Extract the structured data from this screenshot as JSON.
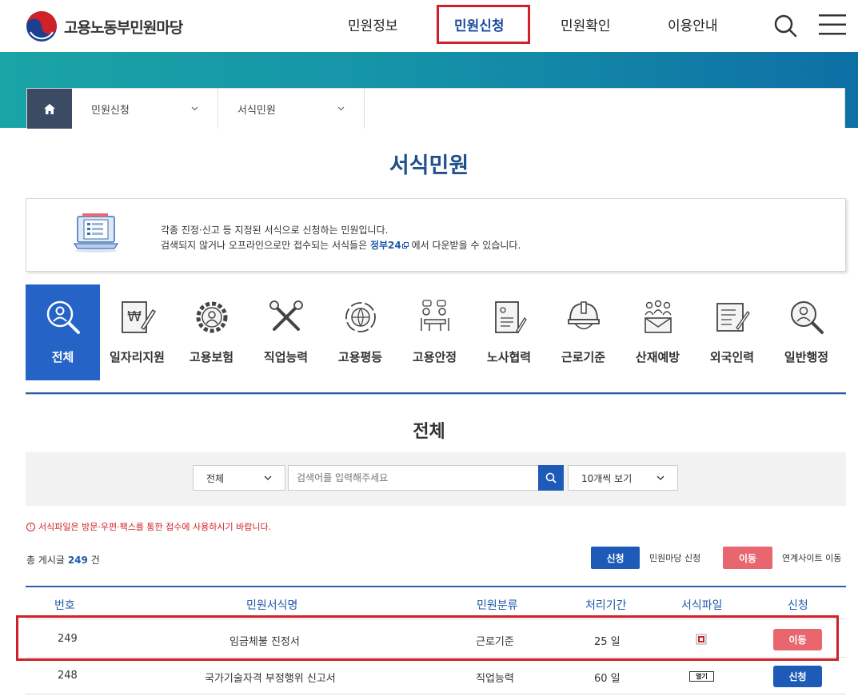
{
  "header": {
    "logo_text": "고용노동부민원마당",
    "nav": [
      "민원정보",
      "민원신청",
      "민원확인",
      "이용안내"
    ],
    "active_nav": "민원신청"
  },
  "breadcrumb": {
    "items": [
      "민원신청",
      "서식민원"
    ]
  },
  "page_title": "서식민원",
  "info": {
    "line1": "각종 진정·신고 등 지정된 서식으로 신청하는 민원입니다.",
    "line2_prefix": "검색되지 않거나 오프라인으로만 접수되는 서식들은",
    "link": "정부24",
    "line2_suffix": "에서 다운받을 수 있습니다."
  },
  "categories": [
    {
      "label": "전체",
      "icon": "magnifier-person-icon",
      "active": true
    },
    {
      "label": "일자리지원",
      "icon": "won-document-icon"
    },
    {
      "label": "고용보험",
      "icon": "gear-person-icon"
    },
    {
      "label": "직업능력",
      "icon": "tools-icon"
    },
    {
      "label": "고용평등",
      "icon": "globe-arrows-icon"
    },
    {
      "label": "고용안정",
      "icon": "meeting-icon"
    },
    {
      "label": "노사협력",
      "icon": "document-pen-icon"
    },
    {
      "label": "근로기준",
      "icon": "helmet-icon"
    },
    {
      "label": "산재예방",
      "icon": "people-mail-icon"
    },
    {
      "label": "외국인력",
      "icon": "checklist-pen-icon"
    },
    {
      "label": "일반행정",
      "icon": "magnifier-person-icon"
    }
  ],
  "section_title": "전체",
  "search": {
    "scope_select": "전체",
    "placeholder": "검색어를 입력해주세요",
    "page_size_select": "10개씩 보기"
  },
  "notice": "서식파일은 방문·우편·팩스를 통한 접수에 사용하시기 바랍니다.",
  "total": {
    "prefix": "총 게시글",
    "count": "249",
    "suffix": "건"
  },
  "legend": {
    "apply_badge": "신청",
    "apply_text": "민원마당 신청",
    "move_badge": "이동",
    "move_text": "연계사이트 이동"
  },
  "table": {
    "headers": [
      "번호",
      "민원서식명",
      "민원분류",
      "처리기간",
      "서식파일",
      "신청"
    ],
    "rows": [
      {
        "no": "249",
        "name": "임금체불 진정서",
        "category": "근로기준",
        "period": "25 일",
        "file": "pdf-icon",
        "action": "이동",
        "action_type": "move"
      },
      {
        "no": "248",
        "name": "국가기술자격 부정행위 신고서",
        "category": "직업능력",
        "period": "60 일",
        "file": "열기",
        "action": "신청",
        "action_type": "apply"
      }
    ]
  },
  "colors": {
    "primary": "#1e5bb8",
    "move": "#e8676f",
    "highlight": "#d0202a",
    "title": "#1f4f8c"
  }
}
